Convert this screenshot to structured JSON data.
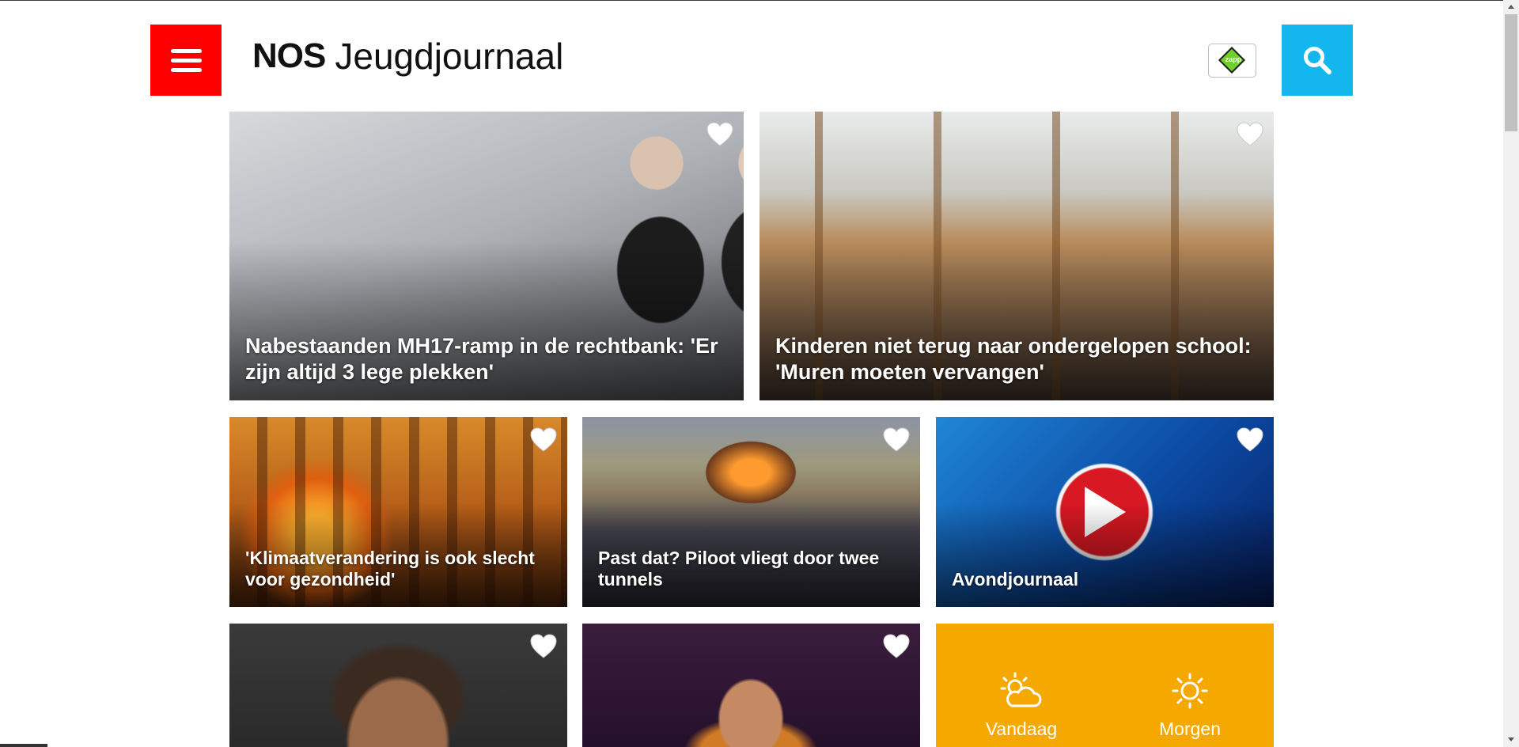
{
  "header": {
    "brand": "NOS",
    "title": "Jeugdjournaal",
    "zapp_label": "zapp",
    "accent_menu": "#ff0000",
    "accent_search": "#13b7ee"
  },
  "tiles": [
    {
      "title": "Nabestaanden MH17-ramp in de rechtbank: 'Er zijn altijd 3 lege plekken'"
    },
    {
      "title": "Kinderen niet terug naar ondergelopen school: 'Muren moeten vervangen'"
    },
    {
      "title": "'Klimaatverandering is ook slecht voor gezondheid'"
    },
    {
      "title": "Past dat? Piloot vliegt door twee tunnels"
    },
    {
      "title": "Avondjournaal"
    },
    {
      "title": ""
    },
    {
      "title": ""
    }
  ],
  "weather": {
    "today": "Vandaag",
    "tomorrow": "Morgen",
    "background": "#f5a800"
  },
  "icons": [
    "menu-icon",
    "search-icon",
    "heart-icon",
    "play-icon",
    "partly-cloudy-icon",
    "sun-icon",
    "zapp-logo"
  ]
}
